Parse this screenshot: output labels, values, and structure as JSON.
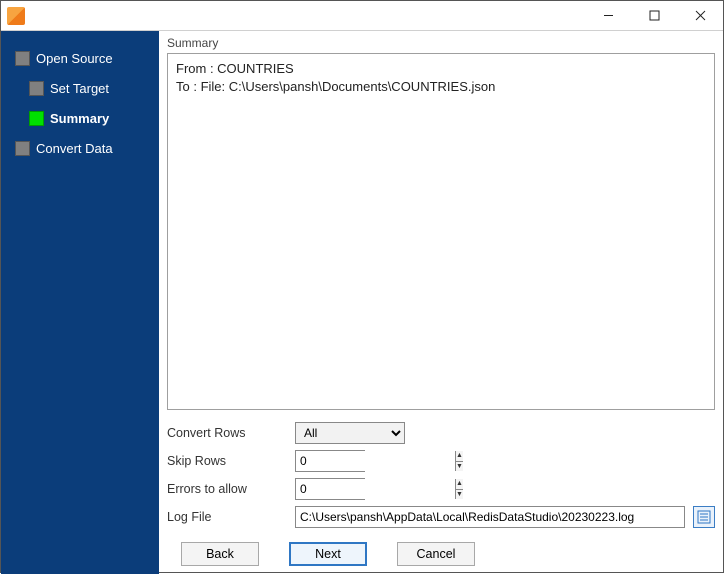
{
  "window": {
    "title": ""
  },
  "sidebar": {
    "items": [
      {
        "label": "Open Source"
      },
      {
        "label": "Set Target"
      },
      {
        "label": "Summary"
      },
      {
        "label": "Convert Data"
      }
    ]
  },
  "summary": {
    "title": "Summary",
    "from_line": "From : COUNTRIES",
    "to_line": "To : File: C:\\Users\\pansh\\Documents\\COUNTRIES.json"
  },
  "form": {
    "convert_rows_label": "Convert Rows",
    "convert_rows_value": "All",
    "skip_rows_label": "Skip Rows",
    "skip_rows_value": "0",
    "errors_label": "Errors to allow",
    "errors_value": "0",
    "log_file_label": "Log File",
    "log_file_value": "C:\\Users\\pansh\\AppData\\Local\\RedisDataStudio\\20230223.log"
  },
  "buttons": {
    "back": "Back",
    "next": "Next",
    "cancel": "Cancel"
  }
}
